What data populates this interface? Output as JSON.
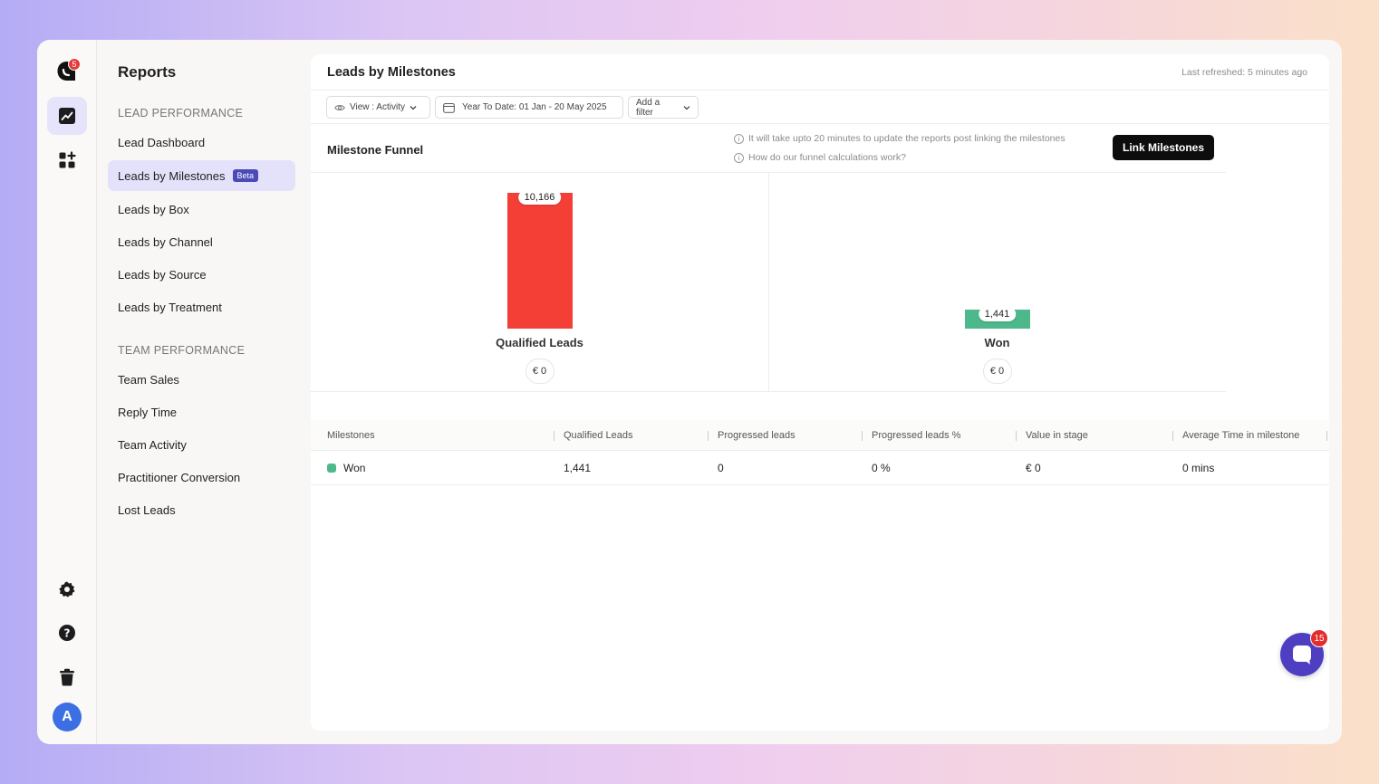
{
  "app": {
    "logo_badge": "5",
    "avatar_initial": "A",
    "chat_badge": "15"
  },
  "sidebar": {
    "title": "Reports",
    "sections": [
      {
        "title": "LEAD PERFORMANCE",
        "items": [
          {
            "label": "Lead Dashboard"
          },
          {
            "label": "Leads by Milestones",
            "badge": "Beta",
            "active": true
          },
          {
            "label": "Leads by Box"
          },
          {
            "label": "Leads by Channel"
          },
          {
            "label": "Leads by Source"
          },
          {
            "label": "Leads by Treatment"
          }
        ]
      },
      {
        "title": "TEAM PERFORMANCE",
        "items": [
          {
            "label": "Team Sales"
          },
          {
            "label": "Reply Time"
          },
          {
            "label": "Team Activity"
          },
          {
            "label": "Practitioner Conversion"
          },
          {
            "label": "Lost Leads"
          }
        ]
      }
    ]
  },
  "header": {
    "title": "Leads by Milestones",
    "refreshed": "Last refreshed: 5 minutes ago"
  },
  "toolbar": {
    "view_label": "View : Activity",
    "date_range": "Year To Date: 01 Jan - 20 May 2025",
    "add_filter": "Add a filter"
  },
  "funnel_head": {
    "title": "Milestone Funnel",
    "info_1": "It will take upto 20 minutes to update the reports post linking the milestones",
    "info_2": "How do our funnel calculations work?",
    "link_button": "Link Milestones"
  },
  "chart_data": {
    "type": "bar",
    "categories": [
      "Qualified Leads",
      "Won"
    ],
    "values": [
      10166,
      1441
    ],
    "value_labels": [
      "10,166",
      "1,441"
    ],
    "stage_values": [
      "€ 0",
      "€ 0"
    ],
    "colors": [
      "#f43f36",
      "#4cb88b"
    ],
    "ylim": [
      0,
      10166
    ]
  },
  "table": {
    "headers": [
      "Milestones",
      "Qualified Leads",
      "Progressed leads",
      "Progressed leads %",
      "Value in stage",
      "Average Time in milestone"
    ],
    "rows": [
      {
        "milestone": "Won",
        "color": "#4cb88b",
        "qualified": "1,441",
        "progressed": "0",
        "progressed_pct": "0 %",
        "value": "€ 0",
        "avg_time": "0 mins"
      }
    ]
  }
}
